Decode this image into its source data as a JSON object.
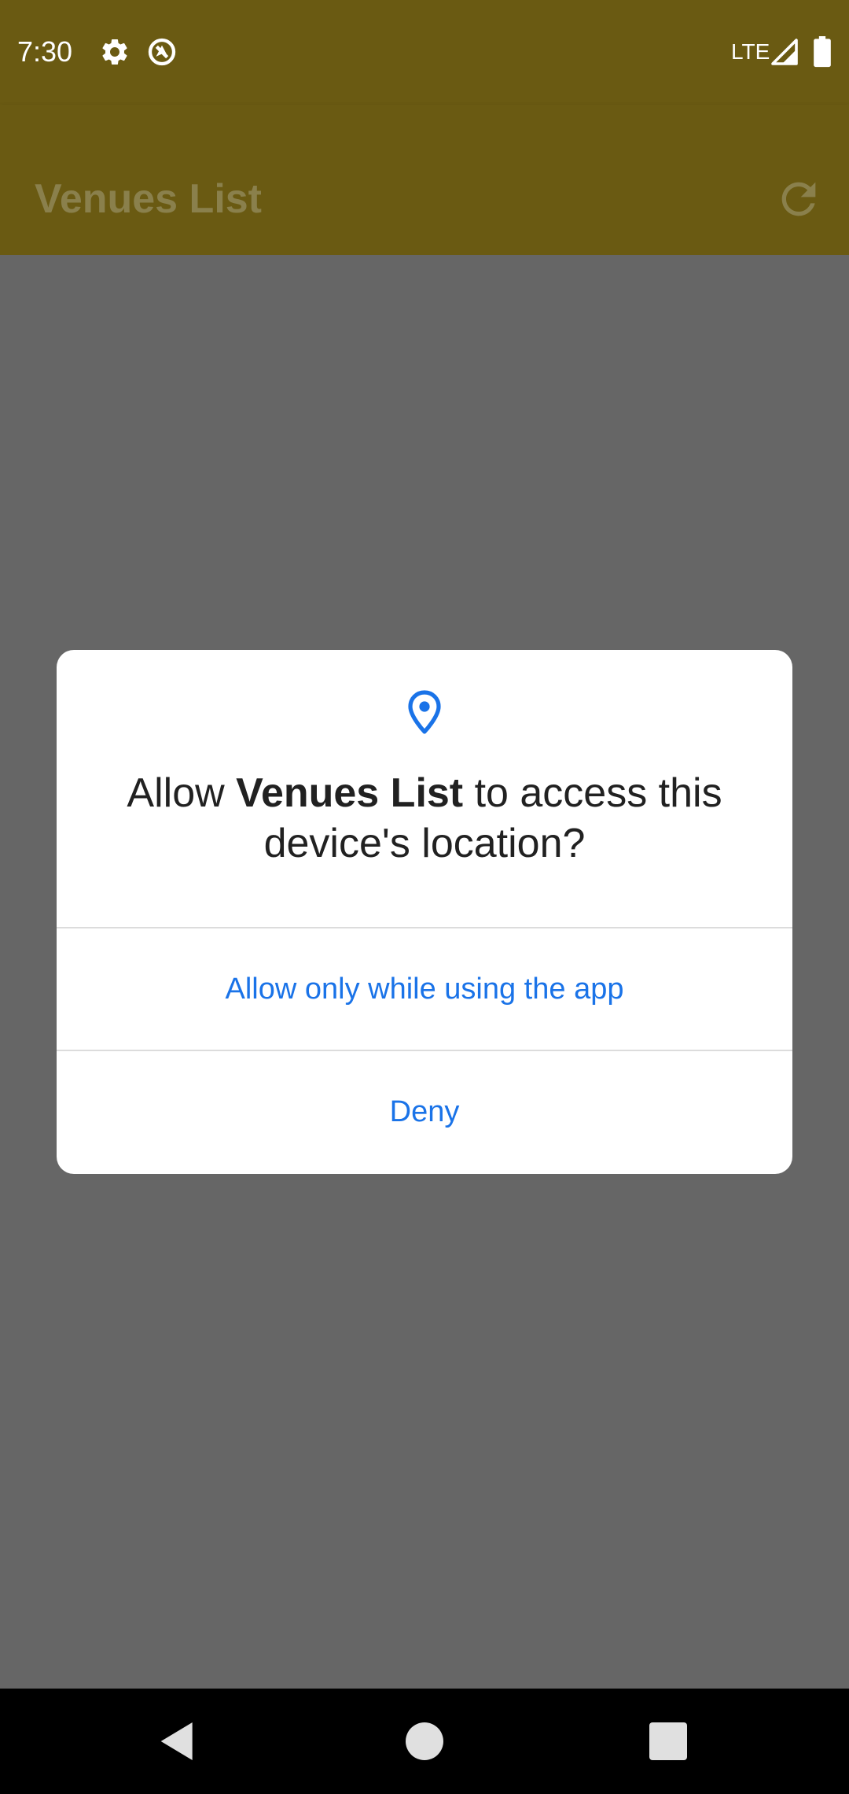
{
  "status_bar": {
    "time": "7:30",
    "network": "LTE",
    "icons": [
      "gear-icon",
      "no-location-icon",
      "signal-icon",
      "battery-icon"
    ]
  },
  "toolbar": {
    "title": "Venues List",
    "refresh_icon": "refresh-icon"
  },
  "dialog": {
    "icon": "location-pin-icon",
    "message_prefix": "Allow ",
    "app_name": "Venues List",
    "message_suffix": " to access this device's location?",
    "allow_label": "Allow only while using the app",
    "deny_label": "Deny"
  },
  "nav_bar": {
    "icons": [
      "back-icon",
      "home-icon",
      "recents-icon"
    ]
  },
  "colors": {
    "toolbar_dimmed": "#6a5a12",
    "scrim_background": "#666666",
    "dialog_accent": "#1a73e8"
  }
}
